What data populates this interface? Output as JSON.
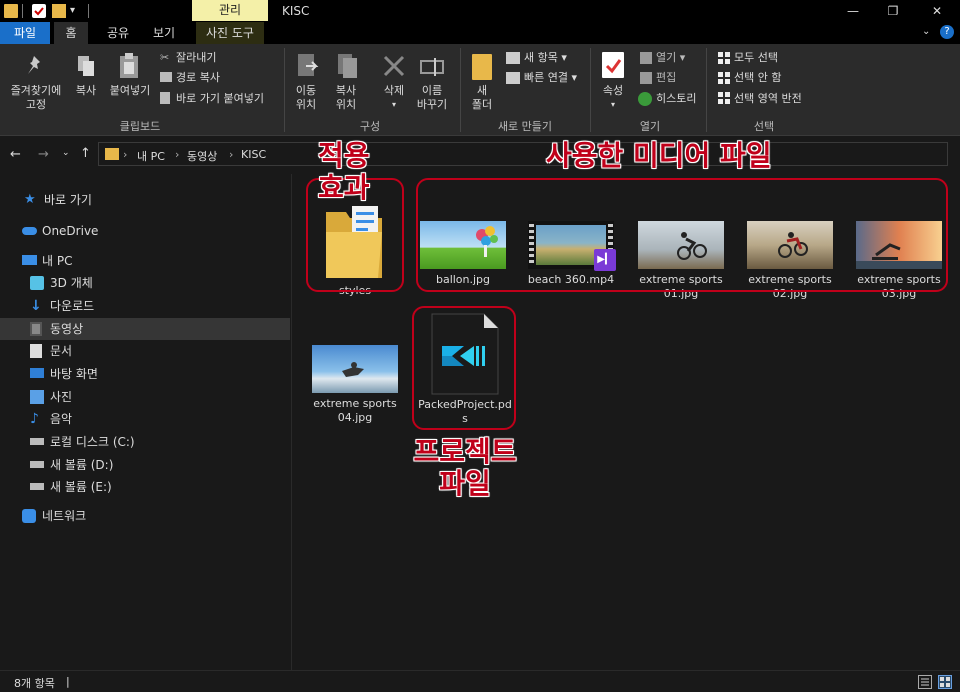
{
  "titlebar": {
    "context_tab": "관리",
    "window_title": "KISC",
    "minimize": "—",
    "maximize": "❐",
    "close": "✕"
  },
  "tabs": {
    "file": "파일",
    "home": "홈",
    "share": "공유",
    "view": "보기",
    "picture_tools": "사진 도구"
  },
  "ribbon": {
    "clipboard": {
      "pin": [
        "즐겨찾기에",
        "고정"
      ],
      "copy": "복사",
      "paste": "붙여넣기",
      "cut": "잘라내기",
      "copy_path": "경로 복사",
      "paste_shortcut": "바로 가기 붙여넣기",
      "group": "클립보드"
    },
    "organize": {
      "move": [
        "이동",
        "위치"
      ],
      "copy_to": [
        "복사",
        "위치"
      ],
      "delete": "삭제",
      "rename": [
        "이름",
        "바꾸기"
      ],
      "group": "구성"
    },
    "new": {
      "new_folder": [
        "새",
        "폴더"
      ],
      "new_item": "새 항목",
      "easy_access": "빠른 연결",
      "group": "새로 만들기"
    },
    "open": {
      "properties": "속성",
      "open": "열기",
      "edit": "편집",
      "history": "히스토리",
      "group": "열기"
    },
    "select": {
      "select_all": "모두 선택",
      "select_none": "선택 안 함",
      "invert": "선택 영역 반전",
      "group": "선택"
    }
  },
  "address": {
    "crumbs": [
      "내 PC",
      "동영상",
      "KISC"
    ],
    "sep": "›"
  },
  "nav": {
    "items": [
      {
        "label": "바로 가기"
      },
      {
        "label": "OneDrive"
      },
      {
        "label": "내 PC"
      },
      {
        "label": "3D 개체"
      },
      {
        "label": "다운로드"
      },
      {
        "label": "동영상"
      },
      {
        "label": "문서"
      },
      {
        "label": "바탕 화면"
      },
      {
        "label": "사진"
      },
      {
        "label": "음악"
      },
      {
        "label": "로컬 디스크 (C:)"
      },
      {
        "label": "새 볼륨 (D:)"
      },
      {
        "label": "새 볼륨 (E:)"
      },
      {
        "label": "네트워크"
      }
    ]
  },
  "files": [
    {
      "name": "styles"
    },
    {
      "name": "ballon.jpg"
    },
    {
      "name": "beach 360.mp4"
    },
    {
      "name": "extreme sports 01.jpg",
      "line1": "extreme sports",
      "line2": "01.jpg"
    },
    {
      "name": "extreme sports 02.jpg",
      "line1": "extreme sports",
      "line2": "02.jpg"
    },
    {
      "name": "extreme sports 03.jpg",
      "line1": "extreme sports",
      "line2": "03.jpg"
    },
    {
      "name": "extreme sports 04.jpg",
      "line1": "extreme sports",
      "line2": "04.jpg"
    },
    {
      "name": "PackedProject.pds",
      "line1": "PackedProject.pd",
      "line2": "s"
    }
  ],
  "annotations": {
    "effects": [
      "적용",
      "효과"
    ],
    "media": "사용한 미디어 파일",
    "project": [
      "프로젝트",
      "파일"
    ],
    "color": "#c0001a"
  },
  "status": {
    "count": "8개 항목",
    "cursor": "|"
  }
}
